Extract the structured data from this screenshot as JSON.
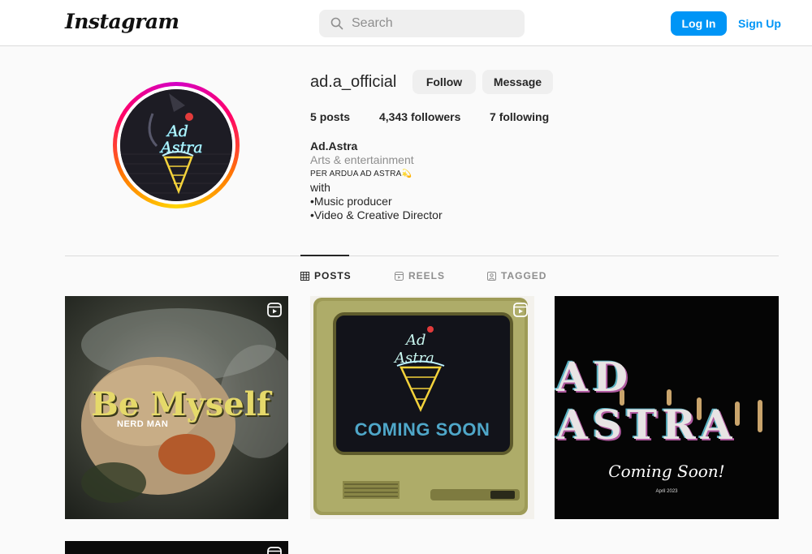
{
  "header": {
    "logo": "Instagram",
    "search_placeholder": "Search",
    "login_label": "Log In",
    "signup_label": "Sign Up"
  },
  "profile": {
    "username": "ad.a_official",
    "follow_label": "Follow",
    "message_label": "Message",
    "stats": {
      "posts_count": "5",
      "posts_label": "posts",
      "followers_count": "4,343",
      "followers_label": "followers",
      "following_count": "7",
      "following_label": "following"
    },
    "full_name": "Ad.Astra",
    "category": "Arts & entertainment",
    "bio": {
      "line1": "PER ARDUA AD ASTRA💫",
      "line2": "with",
      "line3": "•Music producer",
      "line4": "•Video & Creative Director"
    }
  },
  "tabs": {
    "posts": "POSTS",
    "reels": "REELS",
    "tagged": "TAGGED"
  },
  "posts": {
    "post1": {
      "title": "Be Myself",
      "subtitle": "NERD MAN",
      "type": "reel"
    },
    "post2": {
      "logo_text": "Ad Astra",
      "title": "COMING SOON",
      "type": "reel"
    },
    "post3": {
      "title": "AD ASTRA",
      "caption": "Coming Soon!",
      "date": "April 2023"
    }
  },
  "colors": {
    "accent": "#0095f6",
    "text": "#262626",
    "muted": "#8e8e8e",
    "border": "#dbdbdb",
    "button_bg": "#efefef"
  }
}
